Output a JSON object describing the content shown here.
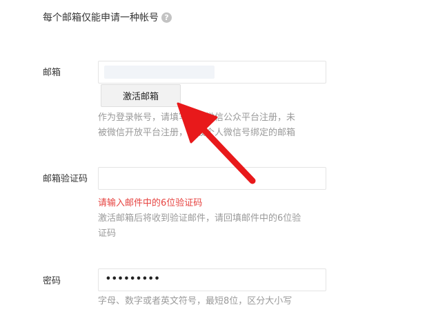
{
  "header": {
    "title": "每个邮箱仅能申请一种帐号",
    "help_icon": "?"
  },
  "email": {
    "label": "邮箱",
    "activate_button": "激活邮箱",
    "hint_line1": "作为登录帐号，请填写未被微信公众平台注册，未",
    "hint_line2": "被微信开放平台注册，未被个人微信号绑定的邮箱"
  },
  "verify": {
    "label": "邮箱验证码",
    "error": "请输入邮件中的6位验证码",
    "hint_line1": "激活邮箱后将收到验证邮件，请回填邮件中的6位验",
    "hint_line2": "证码"
  },
  "password": {
    "label": "密码",
    "value": "•••••••••",
    "hint": "字母、数字或者英文符号，最短8位，区分大小写"
  },
  "annotation": {
    "arrow_color": "#e8191b",
    "icon": "red-arrow-icon"
  }
}
